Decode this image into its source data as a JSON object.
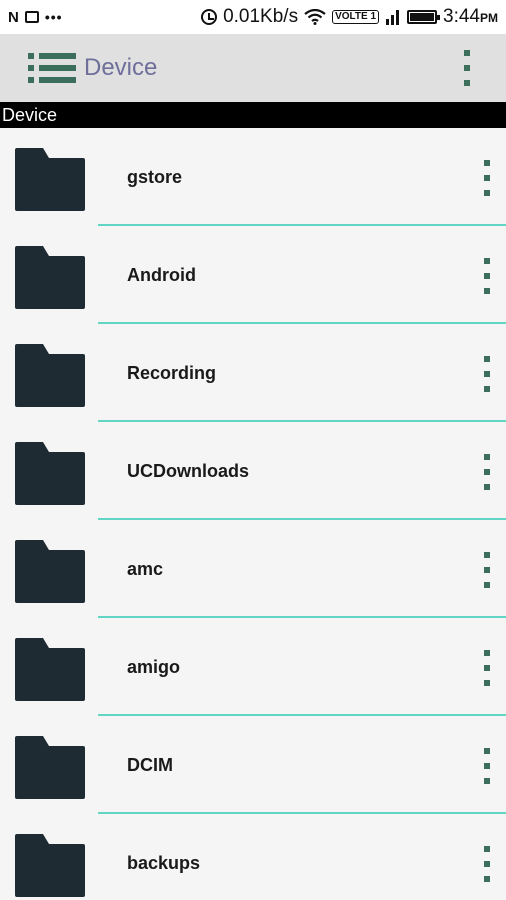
{
  "status_bar": {
    "network_speed": "0.01Kb/s",
    "volte": "VOLTE 1",
    "time": "3:44",
    "ampm": "PM"
  },
  "toolbar": {
    "title": "Device"
  },
  "path_bar": {
    "label": "Device"
  },
  "folders": [
    {
      "name": "gstore"
    },
    {
      "name": "Android"
    },
    {
      "name": "Recording"
    },
    {
      "name": "UCDownloads"
    },
    {
      "name": "amc"
    },
    {
      "name": "amigo"
    },
    {
      "name": "DCIM"
    },
    {
      "name": "backups"
    }
  ],
  "colors": {
    "accent": "#3c6e5c",
    "divider": "#61d6c4",
    "folder": "#1e2b33",
    "title": "#6f6f9c"
  }
}
